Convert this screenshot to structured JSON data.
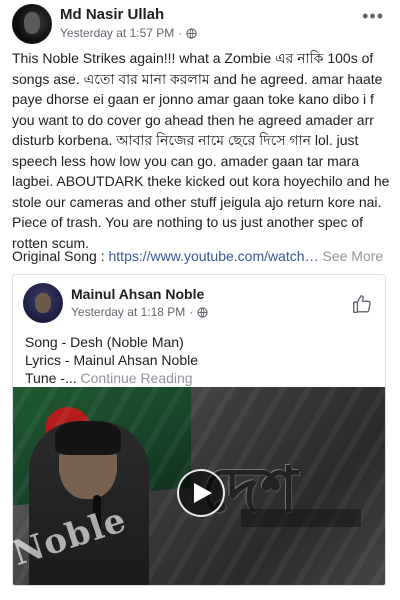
{
  "post": {
    "author": "Md Nasir Ullah",
    "timestamp": "Yesterday at 1:57 PM",
    "privacy_icon": "globe-icon",
    "more_icon": "more-horizontal-icon",
    "more_label": "•••",
    "text": "This Noble Strikes again!!! what a Zombie এর নাকি 100s of songs ase. এতো বার মানা করলাম and he agreed. amar haate paye dhorse ei gaan er jonno amar gaan toke kano dibo i f you want to do cover go ahead then he agreed amader arr disturb korbena. আবার নিজের নামে ছেরে দিসে গান lol. just speech less how low you can go. amader gaan tar mara lagbei. ABOUTDARK theke kicked out kora hoyechilo and he stole our cameras and other stuff jeigula ajo return kore nai. Piece of trash. You are nothing to us just another spec of rotten scum.",
    "original_song_label": "Original Song :",
    "original_song_link": "https://www.youtube.com/watch…",
    "see_more": "See More"
  },
  "shared": {
    "author": "Mainul Ahsan Noble",
    "timestamp": "Yesterday at 1:18 PM",
    "privacy_icon": "globe-icon",
    "like_icon": "thumbs-up-icon",
    "line1": "Song - Desh (Noble Man)",
    "line2": "Lyrics - Mainul Ahsan Noble",
    "line3": "Tune -...",
    "continue_reading": "Continue Reading",
    "video": {
      "title_text": "দেশ",
      "logo_text": "Noble",
      "play_icon": "play-icon"
    }
  },
  "colors": {
    "link": "#385898",
    "muted": "#90949c",
    "meta": "#606770",
    "text": "#1c1e21",
    "border": "#dddfe2"
  }
}
